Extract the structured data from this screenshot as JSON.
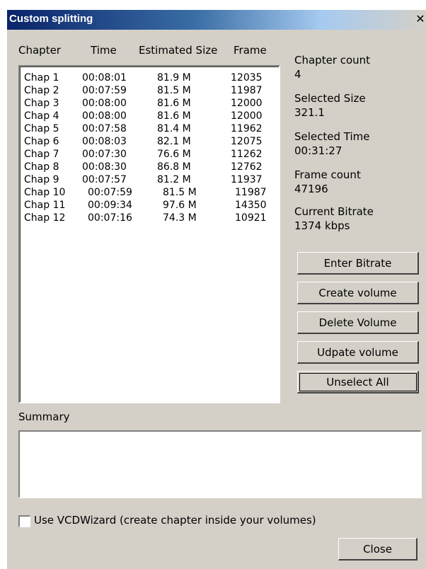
{
  "window": {
    "title": "Custom splitting",
    "close_glyph": "✕"
  },
  "list": {
    "columns": [
      "Chapter",
      "Time",
      "Estimated Size",
      "Frame"
    ],
    "rows": [
      [
        "Chap 1",
        "00:08:01",
        "81.9 M",
        "12035"
      ],
      [
        "Chap 2",
        "00:07:59",
        "81.5 M",
        "11987"
      ],
      [
        "Chap 3",
        "00:08:00",
        "81.6 M",
        "12000"
      ],
      [
        "Chap 4",
        "00:08:00",
        "81.6 M",
        "12000"
      ],
      [
        "Chap 5",
        "00:07:58",
        "81.4 M",
        "11962"
      ],
      [
        "Chap 6",
        "00:08:03",
        "82.1 M",
        "12075"
      ],
      [
        "Chap 7",
        "00:07:30",
        "76.6 M",
        "11262"
      ],
      [
        "Chap 8",
        "00:08:30",
        "86.8 M",
        "12762"
      ],
      [
        "Chap 9",
        "00:07:57",
        "81.2 M",
        "11937"
      ],
      [
        "Chap 10",
        "00:07:59",
        "81.5 M",
        "11987"
      ],
      [
        "Chap 11",
        "00:09:34",
        "97.6 M",
        "14350"
      ],
      [
        "Chap 12",
        "00:07:16",
        "74.3 M",
        "10921"
      ]
    ]
  },
  "stats": {
    "chapter_count_label": "Chapter count",
    "chapter_count_value": "4",
    "selected_size_label": "Selected Size",
    "selected_size_value": "321.1",
    "selected_time_label": "Selected Time",
    "selected_time_value": "00:31:27",
    "frame_count_label": "Frame count",
    "frame_count_value": "47196",
    "bitrate_label": "Current Bitrate",
    "bitrate_value": "1374 kbps"
  },
  "buttons": {
    "enter_bitrate": "Enter Bitrate",
    "create_volume": "Create volume",
    "delete_volume": "Delete Volume",
    "update_volume": "Udpate volume",
    "unselect_all": "Unselect All",
    "close": "Close"
  },
  "summary": {
    "label": "Summary",
    "value": ""
  },
  "options": {
    "use_vcdwizard_label": "Use VCDWizard (create chapter inside your volumes)",
    "use_vcdwizard_checked": false
  },
  "colors": {
    "title_start": "#0a246a",
    "title_end": "#a6caf0",
    "dialog_bg": "#d4d0c8"
  }
}
